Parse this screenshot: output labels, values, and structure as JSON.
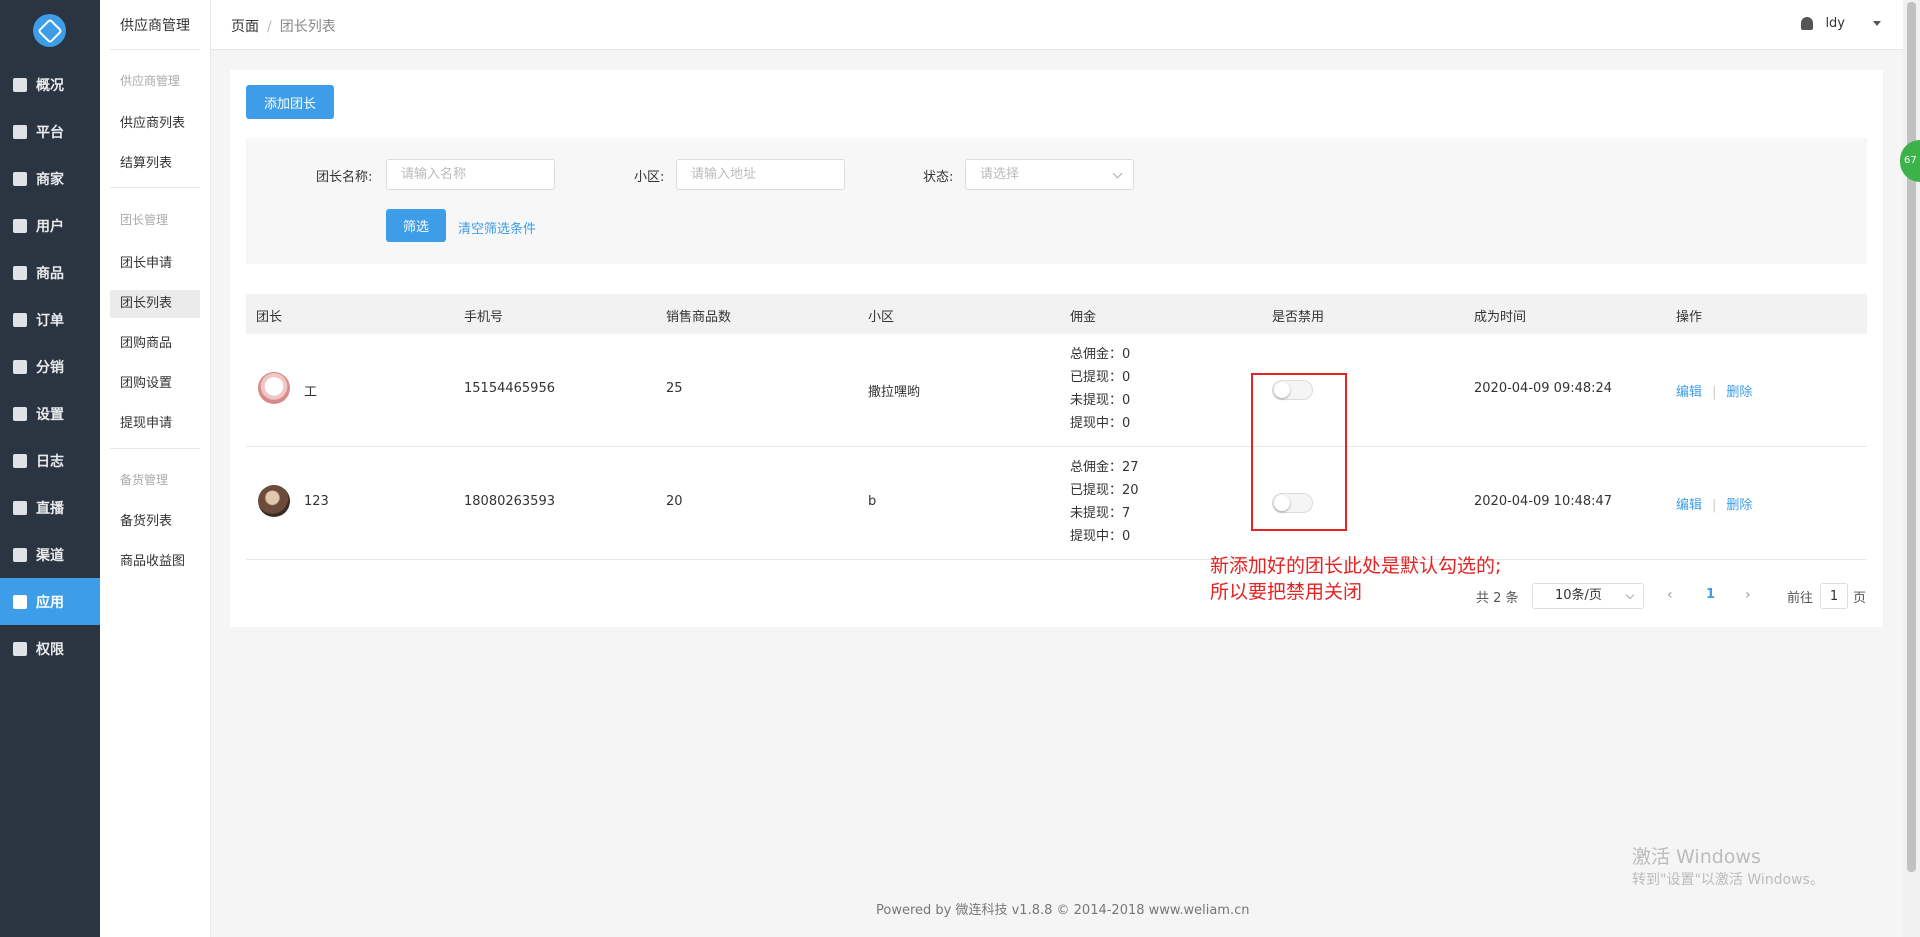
{
  "sidebar": {
    "items": [
      {
        "label": "概况",
        "icon": "dashboard-icon"
      },
      {
        "label": "平台",
        "icon": "monitor-icon"
      },
      {
        "label": "商家",
        "icon": "store-icon"
      },
      {
        "label": "用户",
        "icon": "user-icon"
      },
      {
        "label": "商品",
        "icon": "goods-icon"
      },
      {
        "label": "订单",
        "icon": "order-icon"
      },
      {
        "label": "分销",
        "icon": "distribution-icon"
      },
      {
        "label": "设置",
        "icon": "gear-icon"
      },
      {
        "label": "日志",
        "icon": "log-icon"
      },
      {
        "label": "直播",
        "icon": "live-icon"
      },
      {
        "label": "渠道",
        "icon": "channel-icon"
      },
      {
        "label": "应用",
        "icon": "apps-icon",
        "active": true
      },
      {
        "label": "权限",
        "icon": "lock-icon"
      }
    ]
  },
  "subnav": {
    "title": "供应商管理",
    "group1": "供应商管理",
    "supplier_list": "供应商列表",
    "settlement_list": "结算列表",
    "group2": "团长管理",
    "leader_apply": "团长申请",
    "leader_list": "团长列表",
    "group_goods": "团购商品",
    "group_settings": "团购设置",
    "withdraw_apply": "提现申请",
    "group3": "备货管理",
    "stock_list": "备货列表",
    "goods_profit": "商品收益图"
  },
  "breadcrumb": {
    "root": "页面",
    "separator": "/",
    "current": "团长列表"
  },
  "user": {
    "name": "ldy"
  },
  "float_badge": "67",
  "toolbar": {
    "add_label": "添加团长"
  },
  "filter": {
    "name_label": "团长名称:",
    "name_placeholder": "请输入名称",
    "area_label": "小区:",
    "area_placeholder": "请输入地址",
    "status_label": "状态:",
    "status_placeholder": "请选择",
    "submit_label": "筛选",
    "clear_label": "清空筛选条件"
  },
  "table": {
    "headers": [
      "团长",
      "手机号",
      "销售商品数",
      "小区",
      "佣金",
      "是否禁用",
      "成为时间",
      "操作"
    ],
    "rows": [
      {
        "name": "工",
        "phone": "15154465956",
        "sales": "25",
        "area": "撒拉嘿哟",
        "c_total": "总佣金：0",
        "c_withdrawn": "已提现：0",
        "c_pending": "未提现：0",
        "c_processing": "提现中：0",
        "disabled": false,
        "time": "2020-04-09 09:48:24",
        "edit": "编辑",
        "delete": "删除"
      },
      {
        "name": "123",
        "phone": "18080263593",
        "sales": "20",
        "area": "b",
        "c_total": "总佣金：27",
        "c_withdrawn": "已提现：20",
        "c_pending": "未提现：7",
        "c_processing": "提现中：0",
        "disabled": false,
        "time": "2020-04-09 10:48:47",
        "edit": "编辑",
        "delete": "删除"
      }
    ]
  },
  "annotation": {
    "line1": "新添加好的团长此处是默认勾选的;",
    "line2": "所以要把禁用关闭",
    "color": "#e62222"
  },
  "pagination": {
    "total": "共 2 条",
    "page_size": "10条/页",
    "prev": "‹",
    "current": "1",
    "next": "›",
    "goto_label": "前往",
    "goto_value": "1",
    "page_label": "页"
  },
  "footer": "Powered by 微连科技 v1.8.8 © 2014-2018 www.weliam.cn",
  "watermark": {
    "title": "激活 Windows",
    "subtitle": "转到\"设置\"以激活 Windows。"
  },
  "colors": {
    "accent": "#3d9de8",
    "sidebar_bg": "#2b3541",
    "alert": "#e62222"
  }
}
